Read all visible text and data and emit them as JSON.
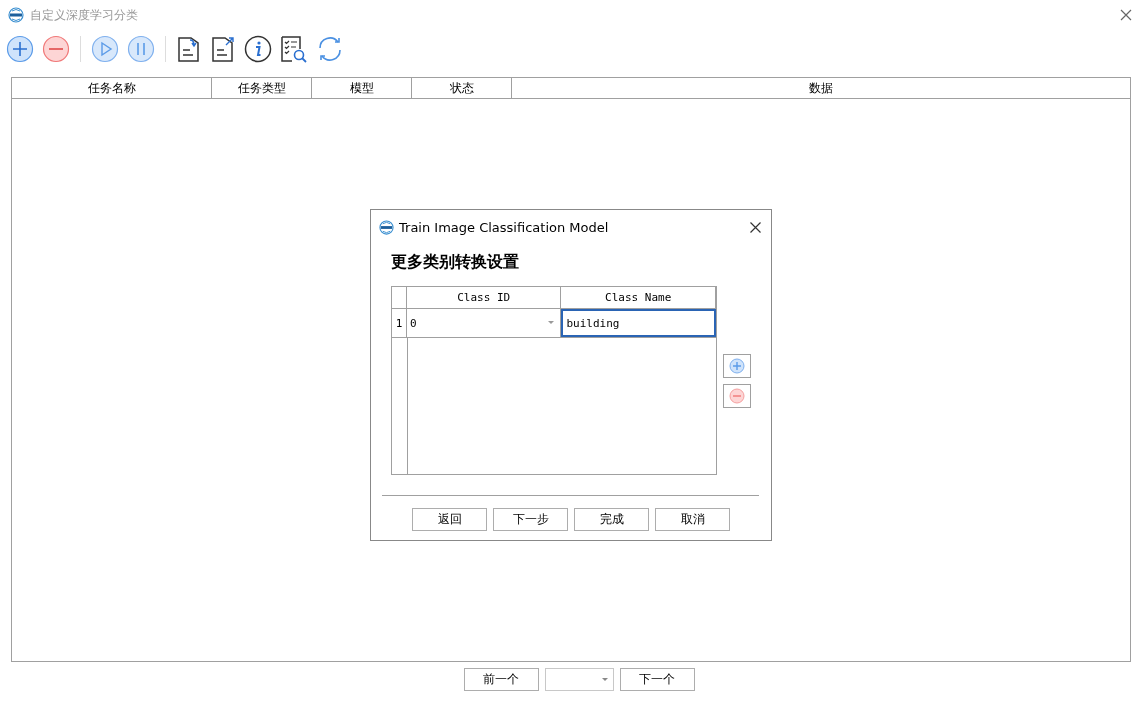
{
  "window": {
    "title": "自定义深度学习分类"
  },
  "table": {
    "columns": [
      "任务名称",
      "任务类型",
      "模型",
      "状态",
      "数据"
    ]
  },
  "pager": {
    "previous": "前一个",
    "next": "下一个"
  },
  "dialog": {
    "title": "Train Image Classification Model",
    "heading": "更多类别转换设置",
    "grid": {
      "columns": [
        "Class ID",
        "Class Name"
      ],
      "rows": [
        {
          "number": "1",
          "class_id": "0",
          "class_name": "building",
          "editing": true
        }
      ]
    },
    "buttons": [
      "返回",
      "下一步",
      "完成",
      "取消"
    ]
  }
}
